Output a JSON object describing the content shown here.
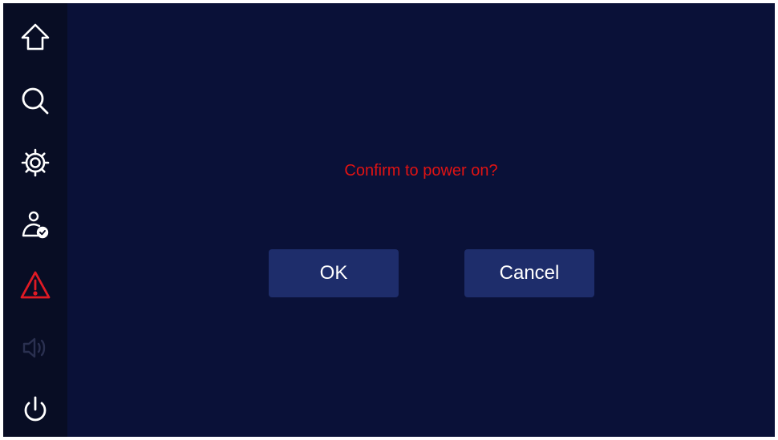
{
  "sidebar": {
    "items": [
      {
        "icon": "home-icon",
        "color": "#ffffff",
        "state": "normal"
      },
      {
        "icon": "search-icon",
        "color": "#ffffff",
        "state": "normal"
      },
      {
        "icon": "gear-icon",
        "color": "#ffffff",
        "state": "normal"
      },
      {
        "icon": "user-check-icon",
        "color": "#ffffff",
        "state": "normal"
      },
      {
        "icon": "warning-icon",
        "color": "#e01a24",
        "state": "alert"
      },
      {
        "icon": "speaker-icon",
        "color": "#2a3050",
        "state": "disabled"
      },
      {
        "icon": "power-icon",
        "color": "#ffffff",
        "state": "normal"
      }
    ]
  },
  "dialog": {
    "message": "Confirm to power on?",
    "message_color": "#e01313",
    "ok_label": "OK",
    "cancel_label": "Cancel"
  },
  "colors": {
    "background": "#0a1138",
    "sidebar": "#080d24",
    "button": "#1e2d6b"
  }
}
